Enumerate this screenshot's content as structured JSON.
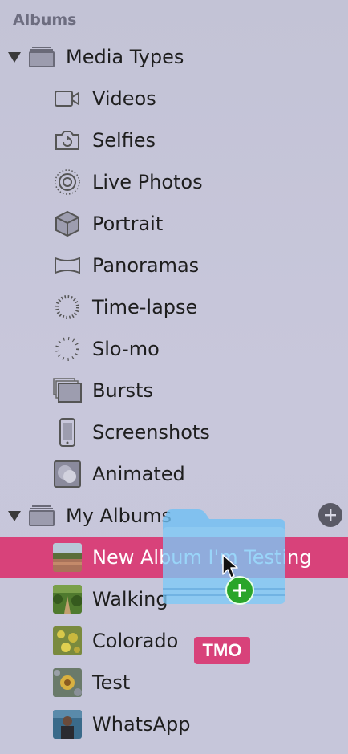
{
  "sidebar": {
    "section_title": "Albums",
    "media_types": {
      "label": "Media Types",
      "items": [
        {
          "label": "Videos",
          "icon": "video-camera-icon"
        },
        {
          "label": "Selfies",
          "icon": "selfie-camera-icon"
        },
        {
          "label": "Live Photos",
          "icon": "live-photo-icon"
        },
        {
          "label": "Portrait",
          "icon": "cube-icon"
        },
        {
          "label": "Panoramas",
          "icon": "panorama-icon"
        },
        {
          "label": "Time-lapse",
          "icon": "time-lapse-icon"
        },
        {
          "label": "Slo-mo",
          "icon": "slo-mo-icon"
        },
        {
          "label": "Bursts",
          "icon": "bursts-icon"
        },
        {
          "label": "Screenshots",
          "icon": "phone-icon"
        },
        {
          "label": "Animated",
          "icon": "animated-icon"
        }
      ]
    },
    "my_albums": {
      "label": "My Albums",
      "items": [
        {
          "label": "New Album I'm Testing",
          "selected": true
        },
        {
          "label": "Walking"
        },
        {
          "label": "Colorado"
        },
        {
          "label": "Test"
        },
        {
          "label": "WhatsApp"
        }
      ]
    }
  },
  "drag_overlay": {
    "folder_icon": "folder-icon",
    "cursor_icon": "arrow-cursor-icon",
    "badge_icon": "plus-icon"
  },
  "watermark": {
    "text": "TMO"
  },
  "colors": {
    "sidebar_bg": "#c5c5d9",
    "selection": "#d8427a",
    "folder_blue": "#6ec0f5",
    "add_badge": "#2aa52a"
  }
}
